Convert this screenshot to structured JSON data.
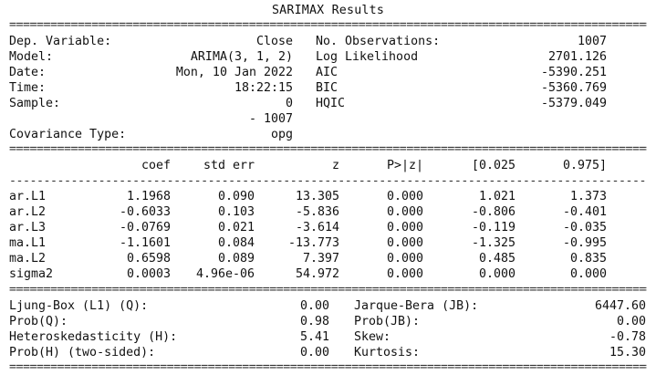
{
  "title": "SARIMAX Results",
  "sep_double": "==============================================================================================================",
  "sep_single": "--------------------------------------------------------------------------------------------------------------",
  "model_info": {
    "left": [
      {
        "label": "Dep. Variable:",
        "value": "Close"
      },
      {
        "label": "Model:",
        "value": "ARIMA(3, 1, 2)"
      },
      {
        "label": "Date:",
        "value": "Mon, 10 Jan 2022"
      },
      {
        "label": "Time:",
        "value": "18:22:15"
      },
      {
        "label": "Sample:",
        "value": "0"
      },
      {
        "label": "",
        "value": "- 1007"
      },
      {
        "label": "Covariance Type:",
        "value": "opg"
      }
    ],
    "right": [
      {
        "label": "No. Observations:",
        "value": "1007"
      },
      {
        "label": "Log Likelihood",
        "value": "2701.126"
      },
      {
        "label": "AIC",
        "value": "-5390.251"
      },
      {
        "label": "BIC",
        "value": "-5360.769"
      },
      {
        "label": "HQIC",
        "value": "-5379.049"
      }
    ]
  },
  "coef_table": {
    "headers": [
      "coef",
      "std err",
      "z",
      "P>|z|",
      "[0.025",
      "0.975]"
    ],
    "rows": [
      {
        "name": "ar.L1",
        "values": [
          "1.1968",
          "0.090",
          "13.305",
          "0.000",
          "1.021",
          "1.373"
        ]
      },
      {
        "name": "ar.L2",
        "values": [
          "-0.6033",
          "0.103",
          "-5.836",
          "0.000",
          "-0.806",
          "-0.401"
        ]
      },
      {
        "name": "ar.L3",
        "values": [
          "-0.0769",
          "0.021",
          "-3.614",
          "0.000",
          "-0.119",
          "-0.035"
        ]
      },
      {
        "name": "ma.L1",
        "values": [
          "-1.1601",
          "0.084",
          "-13.773",
          "0.000",
          "-1.325",
          "-0.995"
        ]
      },
      {
        "name": "ma.L2",
        "values": [
          "0.6598",
          "0.089",
          "7.397",
          "0.000",
          "0.485",
          "0.835"
        ]
      },
      {
        "name": "sigma2",
        "values": [
          "0.0003",
          "4.96e-06",
          "54.972",
          "0.000",
          "0.000",
          "0.000"
        ]
      }
    ]
  },
  "diagnostics": {
    "left": [
      {
        "label": "Ljung-Box (L1) (Q):",
        "value": "0.00"
      },
      {
        "label": "Prob(Q):",
        "value": "0.98"
      },
      {
        "label": "Heteroskedasticity (H):",
        "value": "5.41"
      },
      {
        "label": "Prob(H) (two-sided):",
        "value": "0.00"
      }
    ],
    "right": [
      {
        "label": "Jarque-Bera (JB):",
        "value": "6447.60"
      },
      {
        "label": "Prob(JB):",
        "value": "0.00"
      },
      {
        "label": "Skew:",
        "value": "-0.78"
      },
      {
        "label": "Kurtosis:",
        "value": "15.30"
      }
    ]
  }
}
